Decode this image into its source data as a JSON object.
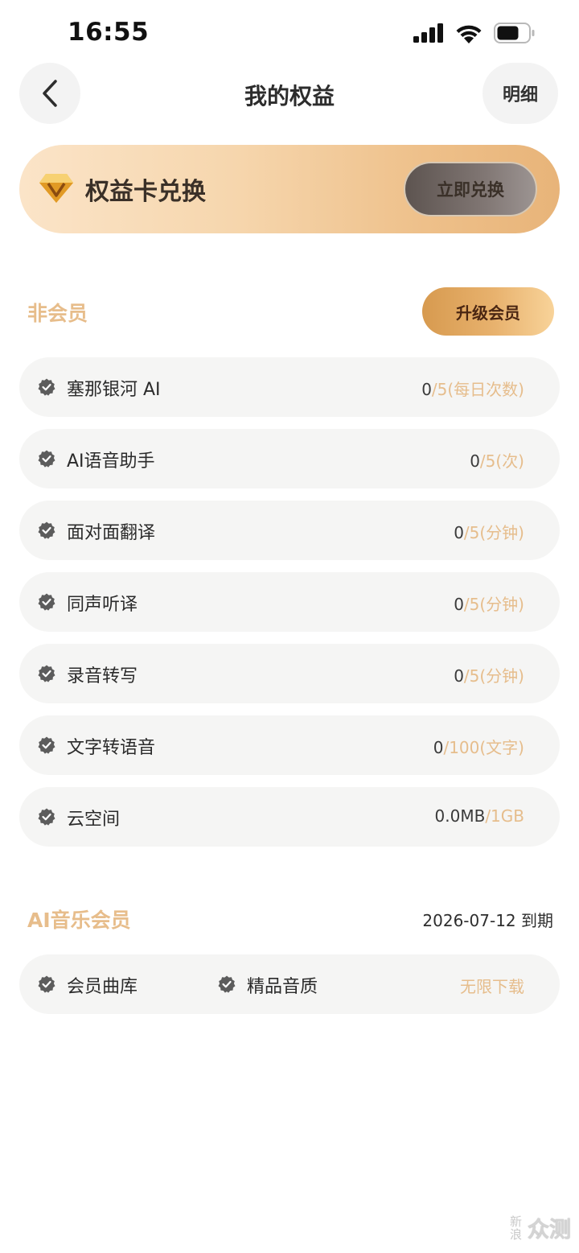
{
  "status_bar": {
    "time": "16:55"
  },
  "nav": {
    "title": "我的权益",
    "detail_label": "明细"
  },
  "redeem": {
    "title": "权益卡兑换",
    "button_label": "立即兑换"
  },
  "free_section": {
    "title": "非会员",
    "upgrade_label": "升级会员",
    "rows": [
      {
        "label": "塞那银河 AI",
        "used": "0",
        "quota": "/5(每日次数)"
      },
      {
        "label": "AI语音助手",
        "used": "0",
        "quota": "/5(次)"
      },
      {
        "label": "面对面翻译",
        "used": "0",
        "quota": "/5(分钟)"
      },
      {
        "label": "同声听译",
        "used": "0",
        "quota": "/5(分钟)"
      },
      {
        "label": "录音转写",
        "used": "0",
        "quota": "/5(分钟)"
      },
      {
        "label": "文字转语音",
        "used": "0",
        "quota": "/100(文字)"
      },
      {
        "label": "云空间",
        "used": "0.0MB",
        "quota": "/1GB"
      }
    ]
  },
  "music_section": {
    "title": "AI音乐会员",
    "expire": "2026-07-12 到期",
    "features": [
      "会员曲库",
      "精品音质"
    ],
    "extra": "无限下载"
  },
  "watermark": {
    "small": "新浪",
    "big": "众测"
  },
  "colors": {
    "accent_gold": "#e6bd8c",
    "row_bg": "#f5f5f4",
    "check_gray": "#5c5c5c"
  }
}
